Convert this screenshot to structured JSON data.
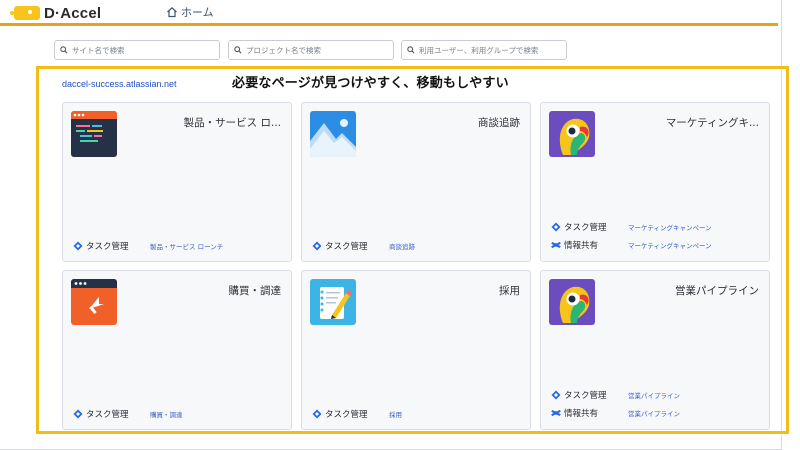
{
  "header": {
    "logo_text": "D·Accel",
    "home_label": "ホーム",
    "accent_color": "#e8a21a"
  },
  "search": {
    "site_placeholder": "サイト名で検索",
    "project_placeholder": "プロジェクト名で検索",
    "user_placeholder": "利用ユーザー、利用グループで検索"
  },
  "main": {
    "site_link": "daccel-success.atlassian.net",
    "headline": "必要なページが見つけやすく、移動もしやすい",
    "highlight_color": "#f2bd19"
  },
  "cards": [
    {
      "title": "製品・サービス ロ...",
      "icon": "code-window-icon",
      "apps": [
        {
          "app": "タスク管理",
          "link": "製品・サービス ローンチ",
          "icon": "jira-icon"
        }
      ]
    },
    {
      "title": "商談追跡",
      "icon": "mountain-image-icon",
      "apps": [
        {
          "app": "タスク管理",
          "link": "商談追跡",
          "icon": "jira-icon"
        }
      ]
    },
    {
      "title": "マーケティングキ...",
      "icon": "parrot-icon",
      "apps": [
        {
          "app": "タスク管理",
          "link": "マーケティングキャンペーン",
          "icon": "jira-icon"
        },
        {
          "app": "情報共有",
          "link": "マーケティングキャンペーン",
          "icon": "confluence-icon"
        }
      ]
    },
    {
      "title": "購買・調達",
      "icon": "cursor-window-icon",
      "apps": [
        {
          "app": "タスク管理",
          "link": "購買・調達",
          "icon": "jira-icon"
        }
      ]
    },
    {
      "title": "採用",
      "icon": "notebook-pencil-icon",
      "apps": [
        {
          "app": "タスク管理",
          "link": "採用",
          "icon": "jira-icon"
        }
      ]
    },
    {
      "title": "営業パイプライン",
      "icon": "parrot-icon",
      "apps": [
        {
          "app": "タスク管理",
          "link": "営業パイプライン",
          "icon": "jira-icon"
        },
        {
          "app": "情報共有",
          "link": "営業パイプライン",
          "icon": "confluence-icon"
        }
      ]
    }
  ]
}
